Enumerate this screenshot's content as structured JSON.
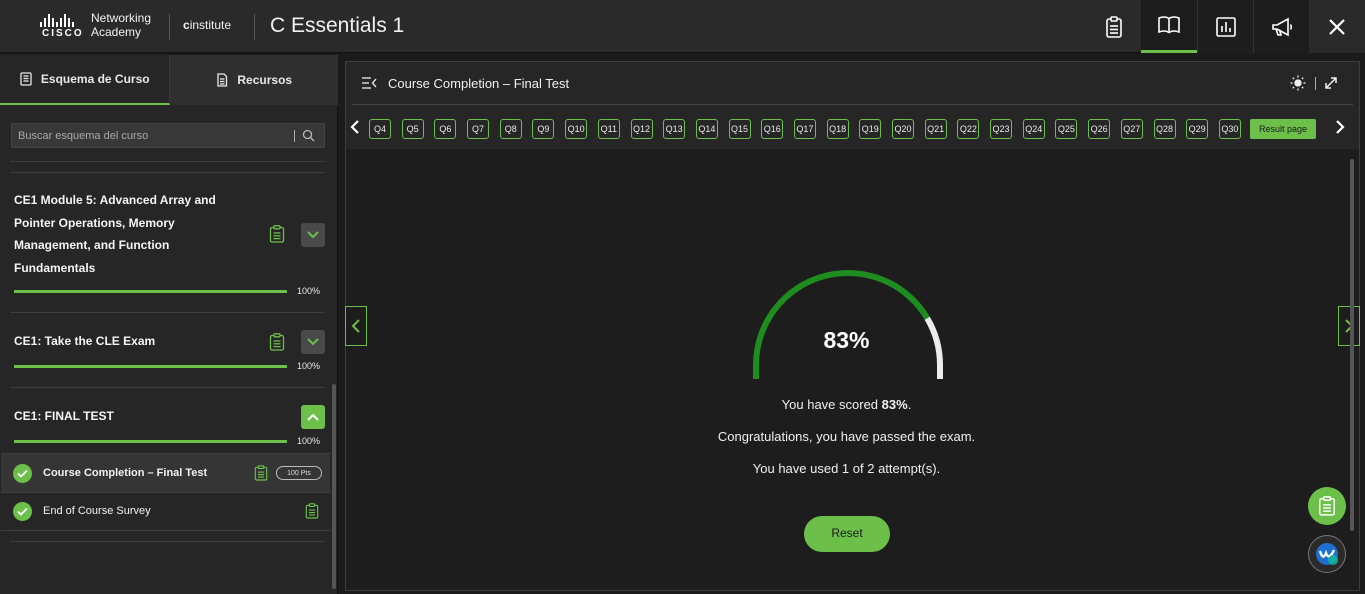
{
  "topbar": {
    "brand_line1": "Networking",
    "brand_line2": "Academy",
    "brand_word": "CISCO",
    "institute_prefix": "c",
    "institute_word": "institute",
    "course_title": "C Essentials 1",
    "icons": [
      "clipboard-icon",
      "book-icon",
      "chart-icon",
      "megaphone-icon",
      "close-icon"
    ]
  },
  "sidebar": {
    "tabs": [
      {
        "label": "Esquema de Curso",
        "icon": "outline-icon"
      },
      {
        "label": "Recursos",
        "icon": "document-icon"
      }
    ],
    "search_placeholder": "Buscar esquema del curso",
    "modules": [
      {
        "title_lines": [
          "CE1 Module 5: Advanced Array and",
          "Pointer Operations, Memory",
          "Management, and Function",
          "Fundamentals"
        ],
        "progress_pct": 100,
        "progress_label": "100%",
        "expanded": false
      },
      {
        "title_lines": [
          "CE1: Take the CLE Exam"
        ],
        "progress_pct": 100,
        "progress_label": "100%",
        "expanded": false
      },
      {
        "title_lines": [
          "CE1: FINAL TEST"
        ],
        "progress_pct": 100,
        "progress_label": "100%",
        "expanded": true
      }
    ],
    "lessons": [
      {
        "label": "Course Completion – Final Test",
        "points": "100 Pts",
        "active": true,
        "completed": true
      },
      {
        "label": "End of Course Survey",
        "active": false,
        "completed": true
      }
    ]
  },
  "main": {
    "title": "Course Completion – Final Test",
    "questions": [
      "Q4",
      "Q5",
      "Q6",
      "Q7",
      "Q8",
      "Q9",
      "Q10",
      "Q11",
      "Q12",
      "Q13",
      "Q14",
      "Q15",
      "Q16",
      "Q17",
      "Q18",
      "Q19",
      "Q20",
      "Q21",
      "Q22",
      "Q23",
      "Q24",
      "Q25",
      "Q26",
      "Q27",
      "Q28",
      "Q29",
      "Q30"
    ],
    "result_page_label": "Result page",
    "score_pct": 83,
    "score_label": "83%",
    "scored_prefix": "You have scored ",
    "scored_value": "83%",
    "scored_suffix": ".",
    "passed_text": "Congratulations, you have passed the exam.",
    "attempts_text": "You have used 1 of 2 attempt(s).",
    "reset_label": "Reset"
  },
  "colors": {
    "accent": "#6cc04a",
    "gauge_fill": "#1e8c1e",
    "gauge_rest": "#ececec"
  }
}
